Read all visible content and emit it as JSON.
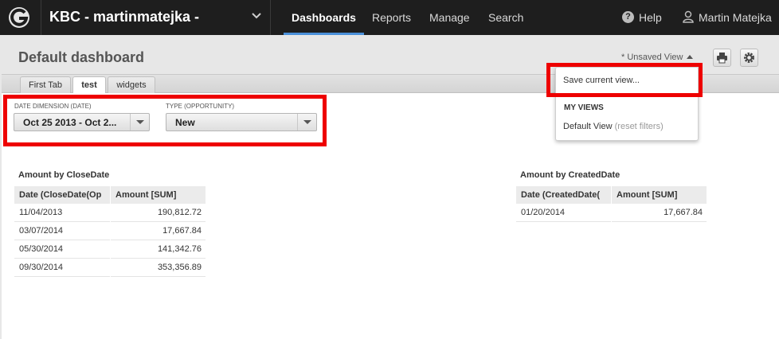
{
  "topbar": {
    "project_name": "KBC - martinmatejka -",
    "nav": [
      "Dashboards",
      "Reports",
      "Manage",
      "Search"
    ],
    "active_nav": "Dashboards",
    "help_label": "Help",
    "user_name": "Martin Matejka"
  },
  "header": {
    "title": "Default dashboard",
    "unsaved_view": "* Unsaved View"
  },
  "tabs": [
    {
      "label": "First Tab",
      "active": false
    },
    {
      "label": "test",
      "active": true
    },
    {
      "label": "widgets",
      "active": false
    }
  ],
  "filters": [
    {
      "label": "DATE DIMENSION (DATE)",
      "value": "Oct 25 2013 - Oct 2..."
    },
    {
      "label": "TYPE (OPPORTUNITY)",
      "value": "New"
    }
  ],
  "view_menu": {
    "save_label": "Save current view...",
    "heading": "MY VIEWS",
    "default_view": "Default View",
    "reset_label": "(reset filters)"
  },
  "tables": {
    "close": {
      "title": "Amount by CloseDate",
      "columns": [
        "Date (CloseDate(Op",
        "Amount [SUM]"
      ],
      "rows": [
        [
          "11/04/2013",
          "190,812.72"
        ],
        [
          "03/07/2014",
          "17,667.84"
        ],
        [
          "05/30/2014",
          "141,342.76"
        ],
        [
          "09/30/2014",
          "353,356.89"
        ]
      ]
    },
    "created": {
      "title": "Amount by CreatedDate",
      "columns": [
        "Date (CreatedDate(",
        "Amount [SUM]"
      ],
      "rows": [
        [
          "01/20/2014",
          "17,667.84"
        ]
      ]
    }
  },
  "colors": {
    "topbar_bg": "#1e1e1e",
    "active_nav_underline": "#4a90d9",
    "highlight": "#ee0000"
  },
  "icons": [
    "g-logo-icon",
    "chevron-down-icon",
    "help-icon",
    "user-icon",
    "printer-icon",
    "gear-icon",
    "caret-up-icon",
    "dropdown-arrow-icon"
  ]
}
